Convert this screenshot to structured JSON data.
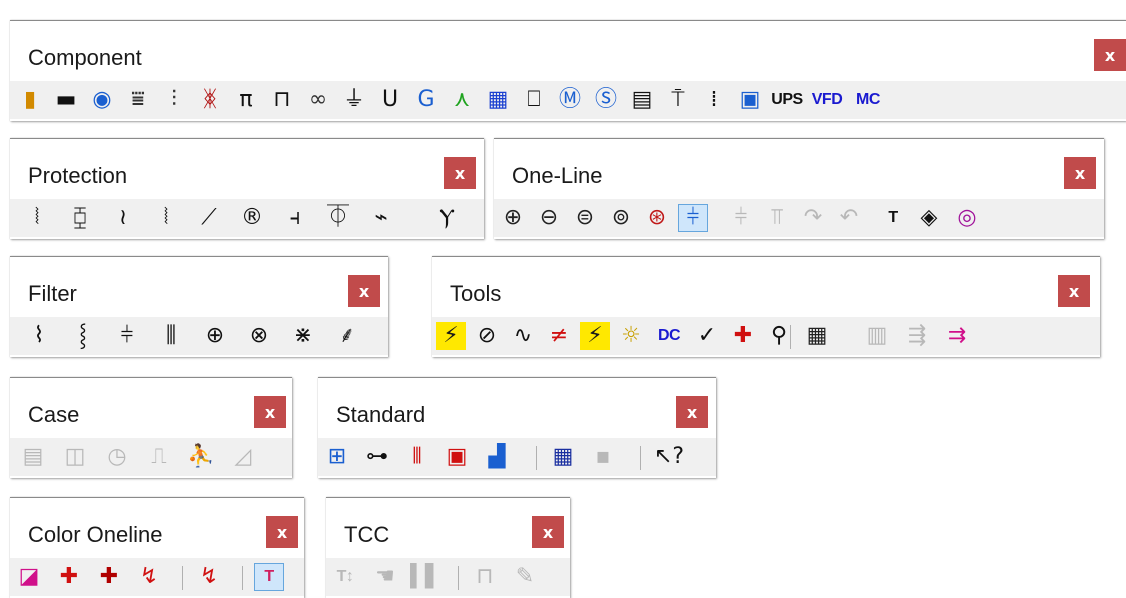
{
  "toolbars": {
    "component": {
      "title": "Component",
      "close": "x",
      "icons": [
        {
          "name": "bar-icon",
          "glyph": "▮",
          "color": "#d28a00"
        },
        {
          "name": "cable-icon",
          "glyph": "▬",
          "color": "#111111"
        },
        {
          "name": "motor-icon",
          "glyph": "◉",
          "color": "#1a5fd0"
        },
        {
          "name": "transformer-icon",
          "glyph": "⩸",
          "color": "#333333"
        },
        {
          "name": "transformer3w-icon",
          "glyph": "⫶",
          "color": "#333333"
        },
        {
          "name": "phase-shifter-icon",
          "glyph": "ᛤ",
          "color": "#b01010"
        },
        {
          "name": "pi-line-icon",
          "glyph": "π",
          "color": "#111111"
        },
        {
          "name": "busway-icon",
          "glyph": "⊓",
          "color": "#111111"
        },
        {
          "name": "reactor-icon",
          "glyph": "∞",
          "color": "#333333"
        },
        {
          "name": "ground-icon",
          "glyph": "⏚",
          "color": "#111111"
        },
        {
          "name": "utility-icon",
          "glyph": "U",
          "color": "#111111"
        },
        {
          "name": "generator-icon",
          "glyph": "G",
          "color": "#1a5fd0"
        },
        {
          "name": "wind-turbine-icon",
          "glyph": "⋏",
          "color": "#1fa31f"
        },
        {
          "name": "solar-panel-icon",
          "glyph": "▦",
          "color": "#1a3fd0"
        },
        {
          "name": "load-icon",
          "glyph": "⎕",
          "color": "#111111"
        },
        {
          "name": "motor-load-icon",
          "glyph": "Ⓜ",
          "color": "#1a5fd0"
        },
        {
          "name": "static-load-icon",
          "glyph": "Ⓢ",
          "color": "#1a5fd0"
        },
        {
          "name": "panel-icon",
          "glyph": "▤",
          "color": "#111111"
        },
        {
          "name": "fuse-icon",
          "glyph": "⍑",
          "color": "#111111"
        },
        {
          "name": "switch-icon",
          "glyph": "⁞",
          "color": "#111111"
        },
        {
          "name": "box-icon",
          "glyph": "▣",
          "color": "#1a5fd0"
        },
        {
          "name": "ups-icon",
          "glyph": "UPS",
          "color": "#111111",
          "text": true
        },
        {
          "name": "vfd-icon",
          "glyph": "VFD",
          "color": "#1a1ad0",
          "text": true
        },
        {
          "name": "mc-icon",
          "glyph": "MC",
          "color": "#1a1ad0",
          "text": true
        }
      ]
    },
    "protection": {
      "title": "Protection",
      "close": "x",
      "icons": [
        {
          "name": "breaker-lv-icon",
          "glyph": "⦚",
          "color": "#111111"
        },
        {
          "name": "breaker-hv-icon",
          "glyph": "⧮",
          "color": "#111111"
        },
        {
          "name": "fuse-prot-icon",
          "glyph": "≀",
          "color": "#111111"
        },
        {
          "name": "breaker-icon",
          "glyph": "⦚",
          "color": "#111111"
        },
        {
          "name": "switch-prot-icon",
          "glyph": "⟋",
          "color": "#111111"
        },
        {
          "name": "relay-icon",
          "glyph": "®",
          "color": "#111111"
        },
        {
          "name": "ct-icon",
          "glyph": "⫞",
          "color": "#111111"
        },
        {
          "name": "pt-icon",
          "glyph": "⏁",
          "color": "#111111"
        },
        {
          "name": "disconnect-icon",
          "glyph": "⌁",
          "color": "#111111"
        },
        {
          "name": "overload-icon",
          "glyph": "Ⲩ",
          "color": "#111111"
        }
      ]
    },
    "oneline": {
      "title": "One-Line",
      "close": "x",
      "icons": [
        {
          "name": "zoom-in-icon",
          "glyph": "⊕",
          "color": "#222222"
        },
        {
          "name": "zoom-out-icon",
          "glyph": "⊖",
          "color": "#222222"
        },
        {
          "name": "zoom-fit-icon",
          "glyph": "⊜",
          "color": "#222222"
        },
        {
          "name": "zoom-area-icon",
          "glyph": "⊚",
          "color": "#222222"
        },
        {
          "name": "zoom-previous-icon",
          "glyph": "⊛",
          "color": "#c01818"
        },
        {
          "name": "grid-toggle-icon",
          "glyph": "⫩",
          "color": "#1a5fd0",
          "selected": true
        },
        {
          "name": "continuity-icon",
          "glyph": "⫩",
          "color": "#b8b8b8",
          "disabled": true
        },
        {
          "name": "continuity-alt-icon",
          "glyph": "⫪",
          "color": "#b8b8b8",
          "disabled": true
        },
        {
          "name": "redo-icon",
          "glyph": "↷",
          "color": "#b8b8b8",
          "disabled": true
        },
        {
          "name": "undo-icon",
          "glyph": "↶",
          "color": "#b8b8b8",
          "disabled": true
        },
        {
          "name": "text-icon",
          "glyph": "T",
          "color": "#111111",
          "text": true
        },
        {
          "name": "theme-icon",
          "glyph": "◈",
          "color": "#111111"
        },
        {
          "name": "ring-icon",
          "glyph": "◎",
          "color": "#a0129a"
        }
      ]
    },
    "filter": {
      "title": "Filter",
      "close": "x",
      "icons": [
        {
          "name": "filter-r-icon",
          "glyph": "⌇",
          "color": "#111111"
        },
        {
          "name": "filter-rl-icon",
          "glyph": "⸾",
          "color": "#111111"
        },
        {
          "name": "filter-c-icon",
          "glyph": "⫩",
          "color": "#111111"
        },
        {
          "name": "filter-lc-icon",
          "glyph": "⫼",
          "color": "#111111"
        },
        {
          "name": "filter-bp-icon",
          "glyph": "⊕",
          "color": "#111111"
        },
        {
          "name": "filter-hp-icon",
          "glyph": "⊗",
          "color": "#111111"
        },
        {
          "name": "filter-arrester-icon",
          "glyph": "⋇",
          "color": "#111111"
        },
        {
          "name": "filter-surge-icon",
          "glyph": "⸙",
          "color": "#111111"
        }
      ]
    },
    "tools": {
      "title": "Tools",
      "close": "x",
      "icons": [
        {
          "name": "load-flow-icon",
          "glyph": "⚡",
          "color": "#1a1a1a",
          "bg": "#ffe800"
        },
        {
          "name": "short-circuit-icon",
          "glyph": "⊘",
          "color": "#111111"
        },
        {
          "name": "harmonics-icon",
          "glyph": "∿",
          "color": "#111111"
        },
        {
          "name": "motor-start-icon",
          "glyph": "≠",
          "color": "#d01010"
        },
        {
          "name": "arc-flash-icon",
          "glyph": "⚡",
          "color": "#1a1a1a",
          "bg": "#ffe800"
        },
        {
          "name": "lighting-icon",
          "glyph": "☼",
          "color": "#c8a000"
        },
        {
          "name": "dc-icon",
          "glyph": "DC",
          "color": "#1a1ad0",
          "text": true
        },
        {
          "name": "check-icon",
          "glyph": "✓",
          "color": "#111111"
        },
        {
          "name": "medical-cross-icon",
          "glyph": "✚",
          "color": "#d01010"
        },
        {
          "name": "find-icon",
          "glyph": "⚲",
          "color": "#111111"
        },
        {
          "name": "table-report-icon",
          "glyph": "▦",
          "color": "#222222"
        },
        {
          "name": "compare-icon",
          "glyph": "▥",
          "color": "#b8b8b8",
          "disabled": true
        },
        {
          "name": "export-icon",
          "glyph": "⇶",
          "color": "#b8b8b8",
          "disabled": true
        },
        {
          "name": "import-icon",
          "glyph": "⇉",
          "color": "#d0108a"
        }
      ]
    },
    "case": {
      "title": "Case",
      "close": "x",
      "icons": [
        {
          "name": "case-calendar-icon",
          "glyph": "▤",
          "color": "#b8b8b8",
          "disabled": true
        },
        {
          "name": "case-window-icon",
          "glyph": "◫",
          "color": "#b8b8b8",
          "disabled": true
        },
        {
          "name": "case-clock-icon",
          "glyph": "◷",
          "color": "#b8b8b8",
          "disabled": true
        },
        {
          "name": "case-pulse-icon",
          "glyph": "⎍",
          "color": "#b8b8b8",
          "disabled": true
        },
        {
          "name": "case-run-icon",
          "glyph": "⛹",
          "color": "#b8b8b8",
          "disabled": true
        },
        {
          "name": "case-chart-icon",
          "glyph": "◿",
          "color": "#b8b8b8",
          "disabled": true
        }
      ]
    },
    "standard": {
      "title": "Standard",
      "close": "x",
      "icons": [
        {
          "name": "layout-icon",
          "glyph": "⊞",
          "color": "#1a5fd0"
        },
        {
          "name": "tree-icon",
          "glyph": "⊶",
          "color": "#111111"
        },
        {
          "name": "color-bars-icon",
          "glyph": "⦀",
          "color": "#d01010"
        },
        {
          "name": "report-icon",
          "glyph": "▣",
          "color": "#d01010"
        },
        {
          "name": "chart-icon",
          "glyph": "▟",
          "color": "#1a5fd0"
        },
        {
          "name": "calendar-grid-icon",
          "glyph": "▦",
          "color": "#1a2fa0"
        },
        {
          "name": "save-icon",
          "glyph": "▪",
          "color": "#b8b8b8",
          "disabled": true
        },
        {
          "name": "help-pointer-icon",
          "glyph": "↖?",
          "color": "#111111"
        }
      ]
    },
    "color_oneline": {
      "title": "Color Oneline",
      "close": "x",
      "icons": [
        {
          "name": "color-theme-icon",
          "glyph": "◪",
          "color": "#d0108a"
        },
        {
          "name": "color-cross-icon",
          "glyph": "✚",
          "color": "#d01010"
        },
        {
          "name": "color-cross-red-icon",
          "glyph": "✚",
          "color": "#b00000"
        },
        {
          "name": "color-checkmark-icon",
          "glyph": "↯",
          "color": "#d01010"
        },
        {
          "name": "color-check-icon",
          "glyph": "↯",
          "color": "#d01010"
        },
        {
          "name": "color-text-icon",
          "glyph": "T",
          "color": "#d02060",
          "text": true,
          "selected": true
        }
      ]
    },
    "tcc": {
      "title": "TCC",
      "close": "x",
      "icons": [
        {
          "name": "tcc-text-icon",
          "glyph": "T↕",
          "color": "#b8b8b8",
          "disabled": true,
          "text": true
        },
        {
          "name": "tcc-hand-icon",
          "glyph": "☚",
          "color": "#b8b8b8",
          "disabled": true
        },
        {
          "name": "tcc-bars-icon",
          "glyph": "▌▌",
          "color": "#b8b8b8",
          "disabled": true
        },
        {
          "name": "tcc-base-icon",
          "glyph": "⊓",
          "color": "#b8b8b8",
          "disabled": true
        },
        {
          "name": "tcc-pencil-icon",
          "glyph": "✎",
          "color": "#b8b8b8",
          "disabled": true
        }
      ]
    }
  }
}
